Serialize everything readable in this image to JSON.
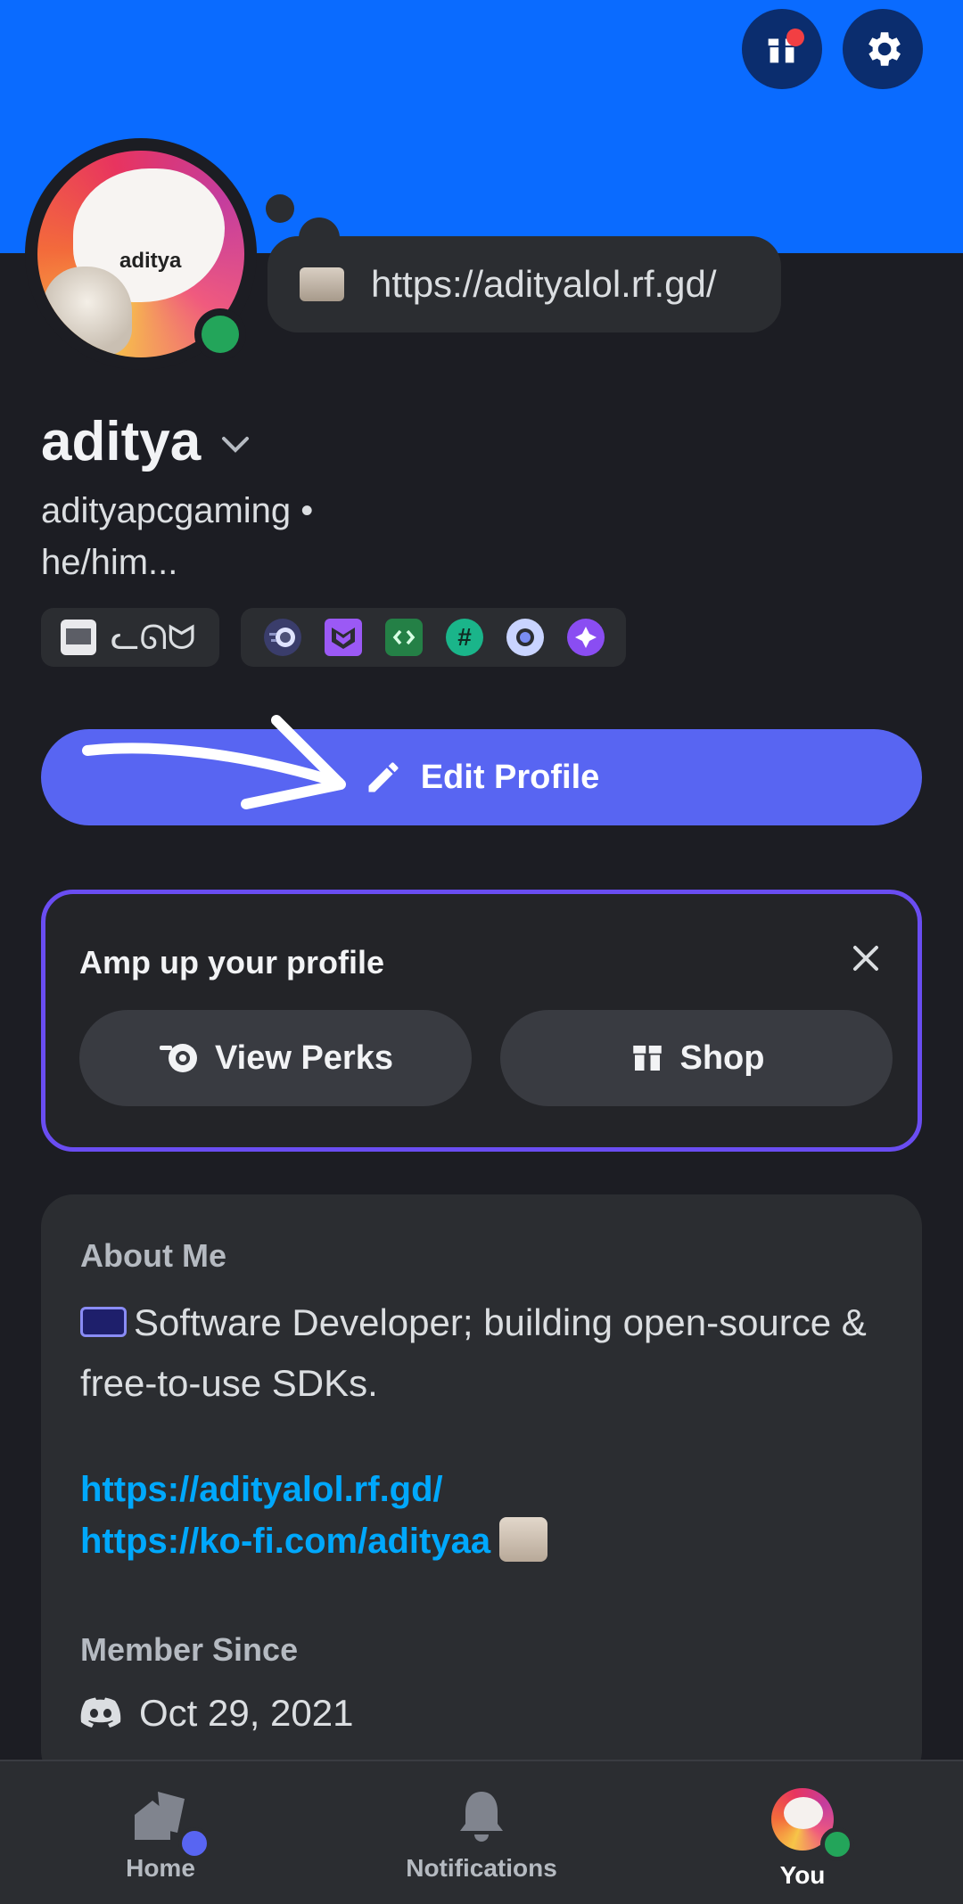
{
  "profile": {
    "avatar_text": "aditya",
    "status_link": "https://adityalol.rf.gd/",
    "display_name": "aditya",
    "username_line": "adityapcgaming •",
    "pronouns": "he/him...",
    "clan_tag": "ᓚᘏᗢ"
  },
  "actions": {
    "edit_profile": "Edit Profile"
  },
  "amp_card": {
    "title": "Amp up your profile",
    "view_perks": "View Perks",
    "shop": "Shop"
  },
  "about": {
    "label": "About Me",
    "text": "Software Developer; building open-source & free-to-use SDKs.",
    "link1": "https://adityalol.rf.gd/",
    "link2": "https://ko-fi.com/adityaa",
    "member_label": "Member Since",
    "member_date": "Oct 29, 2021"
  },
  "nav": {
    "home": "Home",
    "notifications": "Notifications",
    "you": "You"
  },
  "colors": {
    "banner": "#0a6bff",
    "accent": "#5865f2",
    "online": "#23a55a",
    "link": "#00a8fc"
  }
}
